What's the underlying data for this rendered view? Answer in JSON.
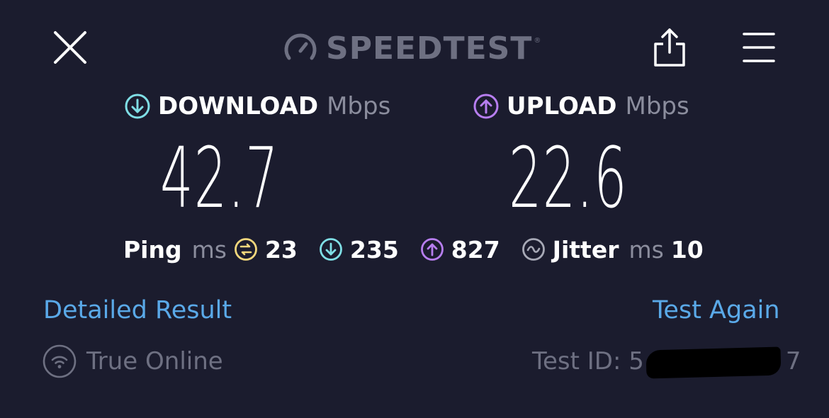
{
  "header": {
    "brand": "SPEEDTEST",
    "brand_mark": "®",
    "icons": {
      "close": "close-icon",
      "logo": "speedometer-icon",
      "share": "share-icon",
      "menu": "menu-icon"
    }
  },
  "download": {
    "label": "DOWNLOAD",
    "unit": "Mbps",
    "value": "42.7",
    "icon": "download-arrow-icon",
    "color": "#7fdfe6"
  },
  "upload": {
    "label": "UPLOAD",
    "unit": "Mbps",
    "value": "22.6",
    "icon": "upload-arrow-icon",
    "color": "#b77ef0"
  },
  "stats": {
    "ping_label": "Ping",
    "ping_unit": "ms",
    "ping_idle": "23",
    "ping_idle_color": "#f3d77c",
    "ping_download": "235",
    "ping_upload": "827",
    "jitter_label": "Jitter",
    "jitter_unit": "ms",
    "jitter_value": "10",
    "jitter_color": "#a7a9b6"
  },
  "actions": {
    "detailed_result": "Detailed Result",
    "test_again": "Test Again",
    "link_color": "#5aa9e8"
  },
  "footer": {
    "provider": "True Online",
    "provider_icon": "wifi-icon",
    "test_id_label": "Test ID: 5",
    "test_id_tail": "7"
  }
}
